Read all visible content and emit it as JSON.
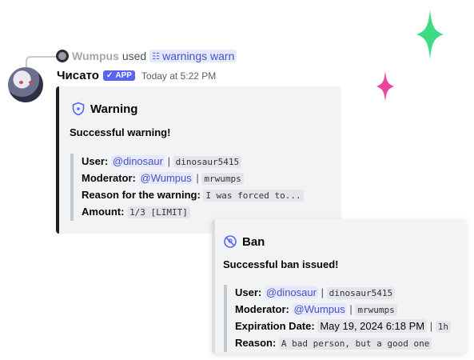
{
  "reply": {
    "user": "Wumpus",
    "used": "used",
    "command": "warnings warn"
  },
  "message": {
    "author": "Чисато",
    "badge": "APP",
    "timestamp": "Today at 5:22 PM"
  },
  "warning_embed": {
    "title": "Warning",
    "description": "Successful warning!",
    "user_label": "User:",
    "user_mention": "@dinosaur",
    "user_name": "dinosaur5415",
    "moderator_label": "Moderator:",
    "moderator_mention": "@Wumpus",
    "moderator_name": "mrwumps",
    "reason_label": "Reason for the warning:",
    "reason_value": "I was forced to...",
    "amount_label": "Amount:",
    "amount_value": "1/3 [LIMIT]"
  },
  "ban_embed": {
    "title": "Ban",
    "description": "Successful ban issued!",
    "user_label": "User:",
    "user_mention": "@dinosaur",
    "user_name": "dinosaur5415",
    "moderator_label": "Moderator:",
    "moderator_mention": "@Wumpus",
    "moderator_name": "mrwumps",
    "expiration_label": "Expiration Date:",
    "expiration_value": "May 19, 2024 6:18 PM",
    "duration_value": "1h",
    "reason_label": "Reason:",
    "reason_value": "A bad person, but a good one"
  },
  "colors": {
    "sparkle_green": "#3ddc84",
    "sparkle_pink": "#eb459e",
    "accent": "#5865f2"
  }
}
